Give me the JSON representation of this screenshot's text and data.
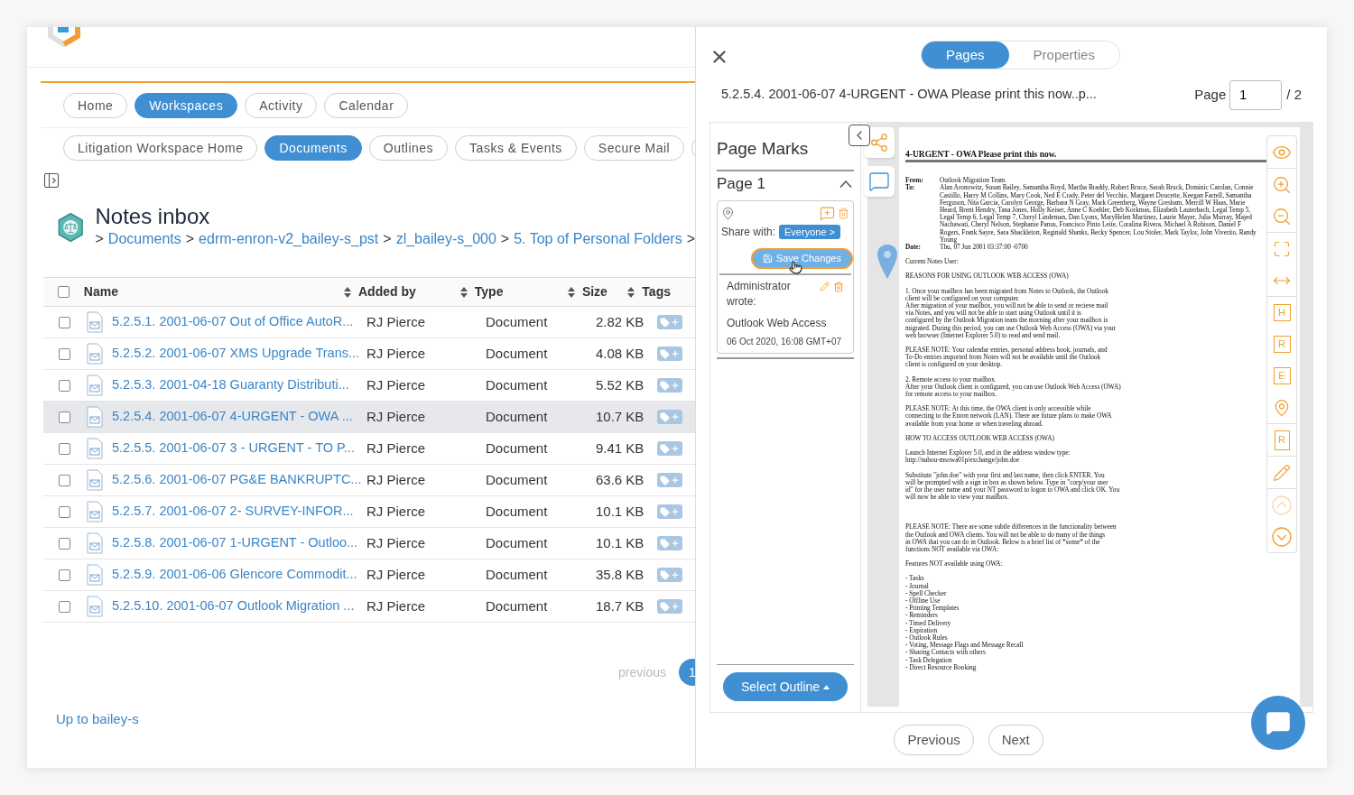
{
  "left": {
    "nav_tabs": [
      {
        "label": "Home",
        "selected": false
      },
      {
        "label": "Workspaces",
        "selected": true
      },
      {
        "label": "Activity",
        "selected": false
      },
      {
        "label": "Calendar",
        "selected": false
      }
    ],
    "sub_tabs": [
      {
        "label": "Litigation Workspace Home",
        "selected": false
      },
      {
        "label": "Documents",
        "selected": true
      },
      {
        "label": "Outlines",
        "selected": false
      },
      {
        "label": "Tasks & Events",
        "selected": false
      },
      {
        "label": "Secure Mail",
        "selected": false
      }
    ],
    "title": "Notes inbox",
    "breadcrumb": [
      {
        "kind": "sep",
        "text": ">"
      },
      {
        "kind": "link",
        "text": "Documents"
      },
      {
        "kind": "sep",
        "text": ">"
      },
      {
        "kind": "link",
        "text": "edrm-enron-v2_bailey-s_pst"
      },
      {
        "kind": "sep",
        "text": ">"
      },
      {
        "kind": "link",
        "text": "zl_bailey-s_000"
      },
      {
        "kind": "sep",
        "text": ">"
      },
      {
        "kind": "link",
        "text": "5. Top of Personal Folders"
      },
      {
        "kind": "sep",
        "text": ">"
      }
    ],
    "table": {
      "header_checked": false,
      "columns": [
        "Name",
        "Added by",
        "Type",
        "Size",
        "Tags"
      ],
      "rows": [
        {
          "name": "5.2.5.1. 2001-06-07 Out of Office AutoR...",
          "added_by": "RJ Pierce",
          "type": "Document",
          "size": "2.82 KB",
          "checked": false,
          "selected": false
        },
        {
          "name": "5.2.5.2. 2001-06-07 XMS Upgrade Trans...",
          "added_by": "RJ Pierce",
          "type": "Document",
          "size": "4.08 KB",
          "checked": false,
          "selected": false
        },
        {
          "name": "5.2.5.3. 2001-04-18 Guaranty Distributi...",
          "added_by": "RJ Pierce",
          "type": "Document",
          "size": "5.52 KB",
          "checked": false,
          "selected": false
        },
        {
          "name": "5.2.5.4. 2001-06-07 4-URGENT - OWA ...",
          "added_by": "RJ Pierce",
          "type": "Document",
          "size": "10.7 KB",
          "checked": false,
          "selected": true
        },
        {
          "name": "5.2.5.5. 2001-06-07 3 - URGENT - TO P...",
          "added_by": "RJ Pierce",
          "type": "Document",
          "size": "9.41 KB",
          "checked": false,
          "selected": false
        },
        {
          "name": "5.2.5.6. 2001-06-07 PG&E BANKRUPTC...",
          "added_by": "RJ Pierce",
          "type": "Document",
          "size": "63.6 KB",
          "checked": false,
          "selected": false
        },
        {
          "name": "5.2.5.7. 2001-06-07 2- SURVEY-INFOR...",
          "added_by": "RJ Pierce",
          "type": "Document",
          "size": "10.1 KB",
          "checked": false,
          "selected": false
        },
        {
          "name": "5.2.5.8. 2001-06-07 1-URGENT - Outloo...",
          "added_by": "RJ Pierce",
          "type": "Document",
          "size": "10.1 KB",
          "checked": false,
          "selected": false
        },
        {
          "name": "5.2.5.9. 2001-06-06 Glencore Commodit...",
          "added_by": "RJ Pierce",
          "type": "Document",
          "size": "35.8 KB",
          "checked": false,
          "selected": false
        },
        {
          "name": "5.2.5.10. 2001-06-07 Outlook Migration ...",
          "added_by": "RJ Pierce",
          "type": "Document",
          "size": "18.7 KB",
          "checked": false,
          "selected": false
        }
      ]
    },
    "pagination": {
      "previous": "previous",
      "page": "1"
    },
    "up_link": "Up to bailey-s"
  },
  "right": {
    "segments": [
      {
        "label": "Pages",
        "selected": true
      },
      {
        "label": "Properties",
        "selected": false
      }
    ],
    "doc_title": "5.2.5.4. 2001-06-07 4-URGENT - OWA Please print this now..p...",
    "page_label": "Page",
    "page_value": "1",
    "page_total": "/ 2",
    "page_marks": {
      "title": "Page Marks",
      "page_header": "Page 1",
      "expanded": true,
      "share_label": "Share with:",
      "share_value": "Everyone >",
      "save": "Save Changes",
      "comment": {
        "author": "Administrator wrote:",
        "body": "Outlook Web Access",
        "date": "06 Oct 2020, 16:08 GMT+07"
      }
    },
    "select_outline": "Select Outline",
    "document": {
      "title": "4-URGENT - OWA Please print this now.",
      "fields": [
        {
          "label": "From:",
          "value": "Outlook Migration Team"
        },
        {
          "label": "To:",
          "value": "Alan Aronowitz, Susan Bailey, Samantha Boyd, Martha Braddy, Robert Bruce, Sarah Bruck, Dominic Carolan, Connie Castillo, Harry M Collins, Mary Cook, Ned E Crady, Peter del Vecchio, Margaret Doucette, Keegan Farrell, Samantha Ferguson, Nita Garcia, Carolyn George, Barbara N Gray, Mark Greenberg, Wayne Gresham, Merrill W Haas, Marie Heard, Brent Hendry, Tana Jones, Holly Keiser, Anne C Koehler, Deb Korkmas, Elizabeth Lauterbach, Legal Temp 5, Legal Temp 6, Legal Temp 7, Cheryl Lindeman, Dan Lyons, MaryHelen Martinez, Laurie Mayer, Julia Murray, Majed Nachawati, Cheryl Nelson, Stephanie Panus, Francisco Pinto Leite, Coralina Rivera, Michael A Robison, Daniel F Rogers, Frank Sayre, Sara Shackleton, Reginald Shanks, Becky Spencer, Lou Stoler, Mark Taylor, John Viverito, Randy Young"
        },
        {
          "label": "Date:",
          "value": "Thu, 07 Jun 2001 03:37:00 -0700"
        }
      ],
      "paragraphs": [
        "Current Notes User:",
        "REASONS FOR USING OUTLOOK WEB ACCESS (OWA)",
        "1. Once your mailbox has been migrated from Notes to Outlook, the Outlook\nclient will be configured on your computer.\nAfter migration of your mailbox, you will not be able to send or recieve mail\nvia Notes, and you will not be able to start using Outlook until it is\nconfigured by the Outlook Migration team the morning after your mailbox is\nmigrated. During this period, you can use Outlook Web Access (OWA) via your\nweb browser (Internet Explorer 5.0) to read and send mail.",
        "PLEASE NOTE: Your calendar entries, personal address book, journals, and\nTo-Do entries imported from Notes will not be available until the Outlook\nclient is configured on your desktop.",
        "2. Remote access to your mailbox.\nAfter your Outlook client is configured, you can use Outlook Web Access (OWA)\nfor remote access to your mailbox.",
        "PLEASE NOTE: At this time, the OWA client is only accessible while\nconnecting to the Enron network (LAN). There are future plans to make OWA\navailable from your home or when traveling abroad.",
        "HOW TO ACCESS OUTLOOK WEB ACCESS (OWA)",
        "Launch Internet Explorer 5.0, and in the address window type:\nhttp://nahou-msowa01p/exchange/john.doe",
        "Substitute \"john.doe\" with your first and last name, then click ENTER. You\nwill be prompted with a sign in box as shown below. Type in \"corp/your user\nid\" for the user name and your NT password to logon to OWA and click OK. You\nwill now be able to view your mailbox.",
        "PLEASE NOTE: There are some subtle differences in the functionality between\nthe Outlook and OWA clients. You will not be able to do many of the things\nin OWA that you can do in Outlook. Below is a brief list of *some* of the\nfunctions NOT available via OWA:",
        "Features NOT available using OWA:",
        "- Tasks\n- Journal\n- Spell Checker\n- Offline Use\n- Printing Templates\n- Reminders\n- Timed Delivery\n- Expiration\n- Outlook Rules\n- Voting, Message Flags and Message Recall\n- Sharing Contacts with others\n- Task Delegation\n- Direct Resource Booking"
      ]
    },
    "letter_tools": [
      {
        "label": "H"
      },
      {
        "label": "R"
      },
      {
        "label": "E"
      }
    ],
    "page_tool_label": "R",
    "scroll_up": {
      "disabled": true
    },
    "scroll_down": {
      "disabled": false
    },
    "nav_buttons": [
      "Previous",
      "Next"
    ]
  }
}
